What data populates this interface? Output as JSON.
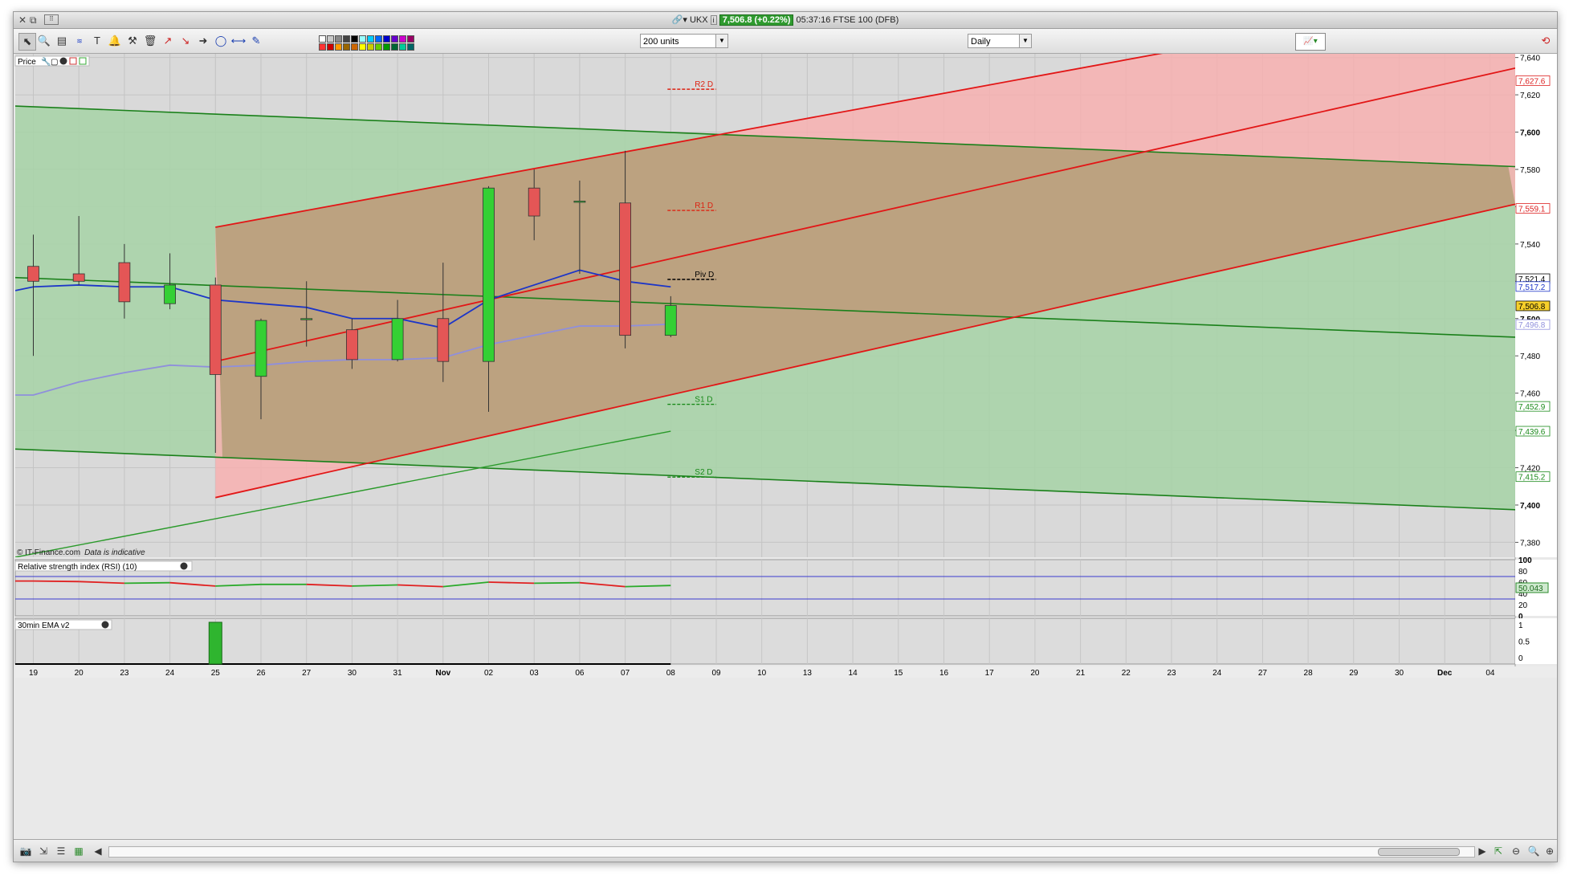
{
  "window": {
    "instrument": "UKX",
    "price_badge": "7,506.8 (+0.22%)",
    "time_market": "05:37:16 FTSE 100 (DFB)"
  },
  "toolbar": {
    "units": "200 units",
    "period": "Daily",
    "tools": [
      "pointer-icon",
      "zoom-icon",
      "chart-icon",
      "fib-icon",
      "text-icon",
      "alarm-icon",
      "hammer-icon",
      "trash-icon",
      "line-up-icon",
      "line-down-icon",
      "arrow-icon",
      "ellipse-icon",
      "hline-icon",
      "pencil-icon"
    ]
  },
  "colors": {
    "candle_up": "#34d034",
    "candle_down": "#e45656",
    "red_line": "#e21616",
    "green_line": "#1a801a",
    "ema_fast": "#1c35c8",
    "ema_slow": "#8f8fdc",
    "fill_green": "#a8d3a8",
    "fill_red": "#f7b0b0",
    "fill_brown": "#b9a17d",
    "plot_bg": "#d9d9d9"
  },
  "price_panel": {
    "label": "Price",
    "watermark_src": "© IT-Finance.com",
    "watermark_note": "Data is indicative"
  },
  "rsi_panel": {
    "label": "Relative strength index (RSI) (10)",
    "scale": [
      "100",
      "80",
      "60",
      "40",
      "20",
      "0"
    ],
    "value_label": "50.043"
  },
  "ema_panel": {
    "label": "30min EMA v2",
    "scale": [
      "1",
      "0.5",
      "0"
    ]
  },
  "chart_data": {
    "type": "candlestick",
    "y_ticks": [
      "7,640",
      "7,620",
      "7,600",
      "7,580",
      "7,560",
      "7,540",
      "7,520",
      "7,500",
      "7,480",
      "7,460",
      "7,440",
      "7,420",
      "7,400",
      "7,380"
    ],
    "ylim": [
      7372,
      7642
    ],
    "x_tick_labels": [
      "19",
      "20",
      "23",
      "24",
      "25",
      "26",
      "27",
      "30",
      "31",
      "Nov",
      "02",
      "03",
      "06",
      "07",
      "08",
      "09",
      "10",
      "13",
      "14",
      "15",
      "16",
      "17",
      "20",
      "21",
      "22",
      "23",
      "24",
      "27",
      "28",
      "29",
      "30",
      "Dec",
      "04"
    ],
    "candles": [
      {
        "date": "19",
        "open": 7528,
        "high": 7545,
        "low": 7480,
        "close": 7520
      },
      {
        "date": "20",
        "open": 7524,
        "high": 7555,
        "low": 7518,
        "close": 7520
      },
      {
        "date": "23",
        "open": 7530,
        "high": 7540,
        "low": 7500,
        "close": 7509
      },
      {
        "date": "24",
        "open": 7508,
        "high": 7535,
        "low": 7505,
        "close": 7518
      },
      {
        "date": "25",
        "open": 7518,
        "high": 7522,
        "low": 7428,
        "close": 7470
      },
      {
        "date": "26",
        "open": 7469,
        "high": 7500,
        "low": 7446,
        "close": 7499
      },
      {
        "date": "27",
        "open": 7500,
        "high": 7520,
        "low": 7485,
        "close": 7500
      },
      {
        "date": "30",
        "open": 7494,
        "high": 7500,
        "low": 7473,
        "close": 7478
      },
      {
        "date": "31",
        "open": 7478,
        "high": 7510,
        "low": 7477,
        "close": 7500
      },
      {
        "date": "Nov",
        "open": 7500,
        "high": 7530,
        "low": 7466,
        "close": 7477
      },
      {
        "date": "02",
        "open": 7477,
        "high": 7571,
        "low": 7450,
        "close": 7570
      },
      {
        "date": "03",
        "open": 7570,
        "high": 7580,
        "low": 7542,
        "close": 7555
      },
      {
        "date": "06",
        "open": 7563,
        "high": 7574,
        "low": 7524,
        "close": 7563
      },
      {
        "date": "07",
        "open": 7562,
        "high": 7590,
        "low": 7484,
        "close": 7491
      },
      {
        "date": "08",
        "open": 7491,
        "high": 7512,
        "low": 7490,
        "close": 7507
      }
    ],
    "series": [
      {
        "values": [
          7517,
          7518,
          7517,
          7517,
          7510,
          7508,
          7506,
          7500,
          7500,
          7495,
          7510,
          7518,
          7526,
          7520,
          7517
        ]
      },
      {
        "values": [
          7459,
          7466,
          7471,
          7475,
          7474,
          7475,
          7477,
          7478,
          7478,
          7479,
          7486,
          7491,
          7496,
          7496,
          7497
        ]
      }
    ],
    "pivot_levels": [
      {
        "label": "R2 D",
        "value": 7623
      },
      {
        "label": "R1 D",
        "value": 7558
      },
      {
        "label": "Piv D",
        "value": 7521
      },
      {
        "label": "S1 D",
        "value": 7454
      },
      {
        "label": "S2 D",
        "value": 7415
      }
    ],
    "price_labels": [
      "7,627.6",
      "7,559.1",
      "7,521.4",
      "7,517.2",
      "7,506.8",
      "7,496.8",
      "7,452.9",
      "7,439.6",
      "7,415.2"
    ],
    "rsi_values": [
      62,
      61,
      58,
      59,
      53,
      56,
      56,
      53,
      55,
      52,
      60,
      58,
      59,
      52,
      54
    ]
  },
  "statusbar": {
    "icons": [
      "screenshot-icon",
      "export-icon",
      "list-icon",
      "indicators-icon",
      "zoom-fit-icon",
      "zoom-out-icon",
      "zoom-in-icon"
    ]
  }
}
